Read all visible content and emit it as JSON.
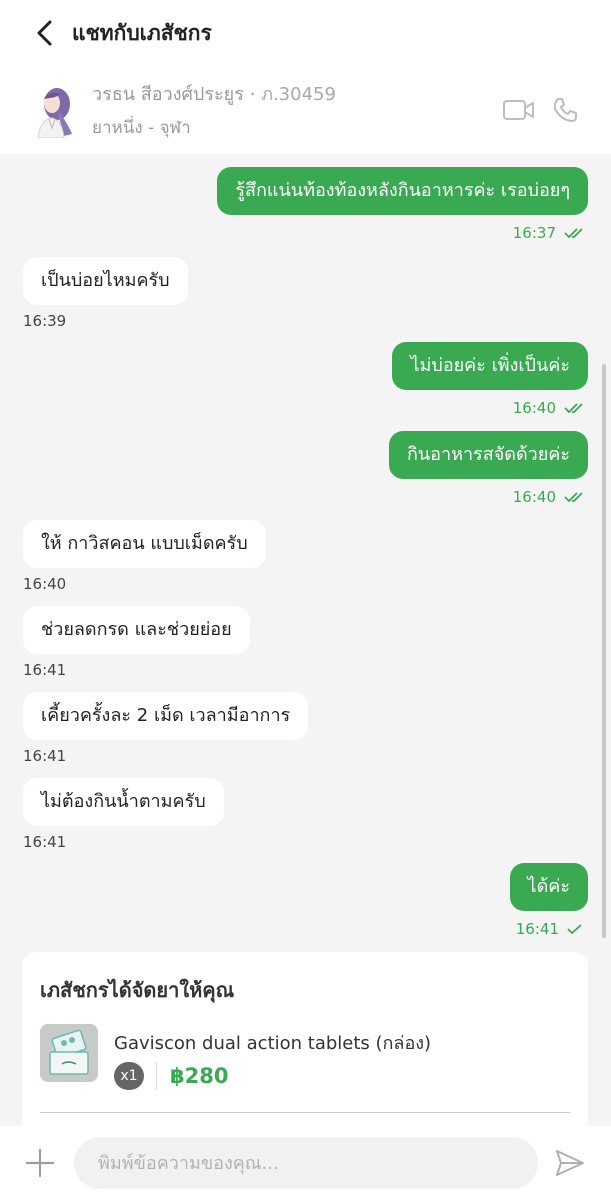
{
  "header": {
    "title": "แชทกับเภสัชกร"
  },
  "pharmacist": {
    "name": "วรธน สีอวงศ์ประยูร",
    "separator": "·",
    "license": "ภ.30459",
    "branch": "ยาหนึ่ง - จุฬา"
  },
  "messages": [
    {
      "dir": "out",
      "text": "รู้สึกแน่นท้องท้องหลังกินอาหารค่ะ เรอบ่อยๆ",
      "time": "16:37",
      "status_icon": "double-check-icon"
    },
    {
      "dir": "in",
      "text": "เป็นบ่อยไหมครับ",
      "time": "16:39"
    },
    {
      "dir": "out",
      "text": "ไม่บ่อยค่ะ เพิ่งเป็นค่ะ",
      "time": "16:40",
      "status_icon": "double-check-icon"
    },
    {
      "dir": "out",
      "text": "กินอาหารสจัดด้วยค่ะ",
      "time": "16:40",
      "status_icon": "double-check-icon"
    },
    {
      "dir": "in",
      "text": "ให้ กาวิสคอน แบบเม็ดครับ",
      "time": "16:40"
    },
    {
      "dir": "in",
      "text": "ช่วยลดกรด และช่วยย่อย",
      "time": "16:41"
    },
    {
      "dir": "in",
      "text": "เคี้ยวครั้งละ 2 เม็ด เวลามีอาการ",
      "time": "16:41"
    },
    {
      "dir": "in",
      "text": "ไม่ต้องกินน้ำตามครับ",
      "time": "16:41"
    },
    {
      "dir": "out",
      "text": "ได้ค่ะ",
      "time": "16:41",
      "status_icon": "check-icon"
    }
  ],
  "order": {
    "title": "เภสัชกรได้จัดยาให้คุณ",
    "product_name": "Gaviscon dual action tablets (กล่อง)",
    "quantity": "x1",
    "price": "฿280"
  },
  "composer": {
    "placeholder": "พิมพ์ข้อความของคุณ..."
  },
  "colors": {
    "accent": "#3aaa52",
    "bubble_in": "#ffffff",
    "background": "#f4f4f4"
  }
}
